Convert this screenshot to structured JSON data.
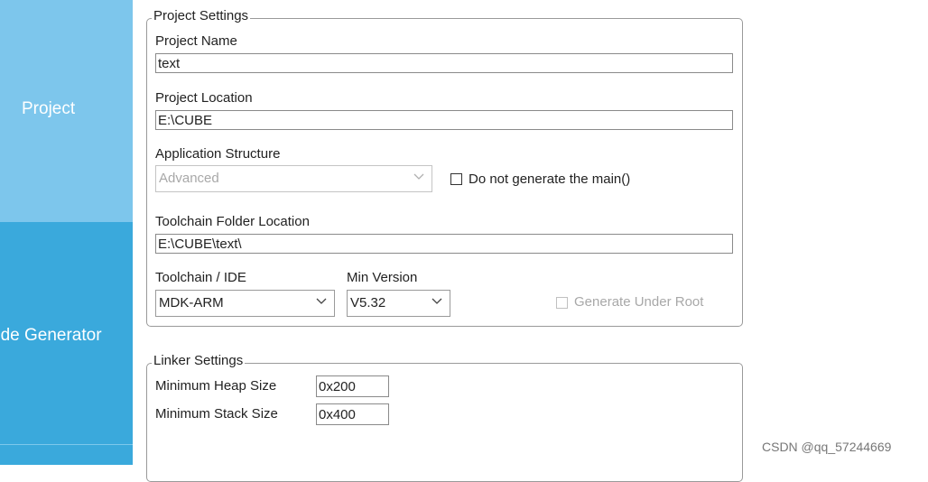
{
  "sidebar": {
    "project_label": "Project",
    "code_generator_label": "ode Generator"
  },
  "project_settings": {
    "title": "Project Settings",
    "project_name_label": "Project Name",
    "project_name_value": "text",
    "project_location_label": "Project Location",
    "project_location_value": "E:\\CUBE",
    "application_structure_label": "Application Structure",
    "application_structure_value": "Advanced",
    "do_not_generate_main_label": "Do not generate the main()",
    "toolchain_folder_label": "Toolchain Folder Location",
    "toolchain_folder_value": "E:\\CUBE\\text\\",
    "toolchain_ide_label": "Toolchain / IDE",
    "toolchain_ide_value": "MDK-ARM",
    "min_version_label": "Min Version",
    "min_version_value": "V5.32",
    "generate_under_root_label": "Generate Under Root"
  },
  "linker_settings": {
    "title": "Linker Settings",
    "min_heap_label": "Minimum Heap Size",
    "min_heap_value": "0x200",
    "min_stack_label": "Minimum Stack Size",
    "min_stack_value": "0x400"
  },
  "watermark": "CSDN @qq_57244669",
  "colors": {
    "sidebar_light": "#7dc6ec",
    "sidebar_dark": "#3aa9dc",
    "border": "#9a9a9a",
    "disabled_text": "#a8a8a8"
  },
  "icons": {
    "dropdown": "chevron-down-icon"
  }
}
